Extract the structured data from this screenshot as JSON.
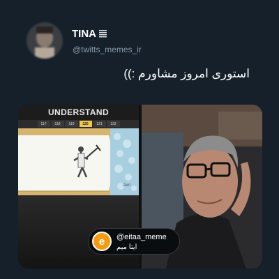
{
  "tweet": {
    "display_name": "TINA",
    "handle": "@twitts_memes_ir",
    "text": "استوری امروز مشاورم :))"
  },
  "media": {
    "left_panel": {
      "game_title": "UNDERSTAND",
      "levels": [
        "117",
        "118",
        "119",
        "120",
        "121",
        "122"
      ],
      "active_level": "120",
      "credit": "Jam"
    }
  },
  "watermark": {
    "handle": "@eitaa_meme",
    "name_fa": "ایتا میم",
    "logo_letter": "e"
  },
  "colors": {
    "background": "#15202b",
    "handle_text": "#8899a6",
    "logo_orange": "#f39c12",
    "level_highlight": "#f1c84a"
  }
}
